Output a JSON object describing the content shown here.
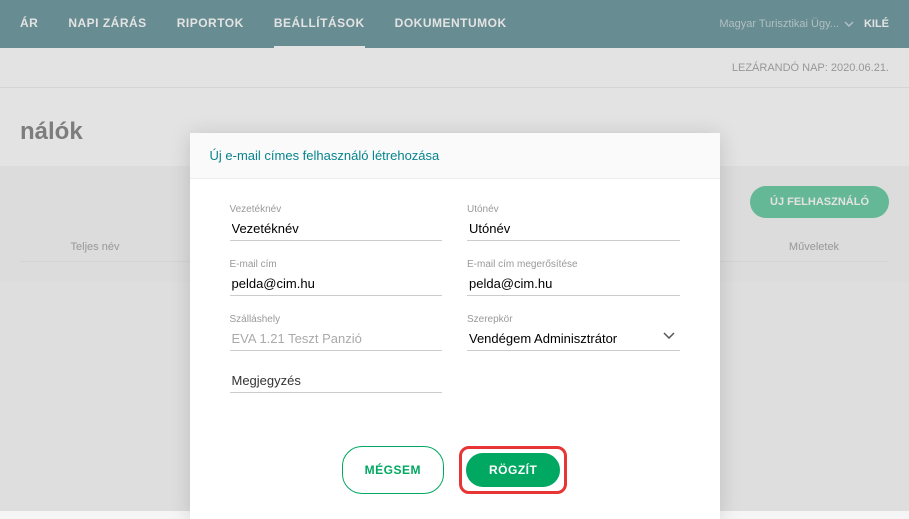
{
  "nav": {
    "items": [
      "ÁR",
      "NAPI ZÁRÁS",
      "RIPORTOK",
      "BEÁLLÍTÁSOK",
      "DOKUMENTUMOK"
    ],
    "active_index": 3,
    "org_label": "Magyar Turisztikai Ügy...",
    "logout": "KILÉ"
  },
  "subbar": {
    "close_date": "LEZÁRANDÓ NAP: 2020.06.21."
  },
  "page": {
    "title": "nálók"
  },
  "actions": {
    "new_user": "ÚJ FELHASZNÁLÓ"
  },
  "table": {
    "col_name": "Teljes név",
    "col_actions": "Műveletek"
  },
  "modal": {
    "title": "Új e-mail címes felhasználó létrehozása",
    "fields": {
      "lastname_label": "Vezetéknév",
      "lastname_value": "Vezetéknév",
      "firstname_label": "Utónév",
      "firstname_value": "Utónév",
      "email_label": "E-mail cím",
      "email_value": "pelda@cim.hu",
      "email_confirm_label": "E-mail cím megerősítése",
      "email_confirm_value": "pelda@cim.hu",
      "accommodation_label": "Szálláshely",
      "accommodation_value": "EVA 1.21 Teszt Panzió",
      "role_label": "Szerepkör",
      "role_value": "Vendégem Adminisztrátor",
      "note_placeholder": "Megjegyzés"
    },
    "cancel": "MÉGSEM",
    "save": "RÖGZÍT"
  }
}
